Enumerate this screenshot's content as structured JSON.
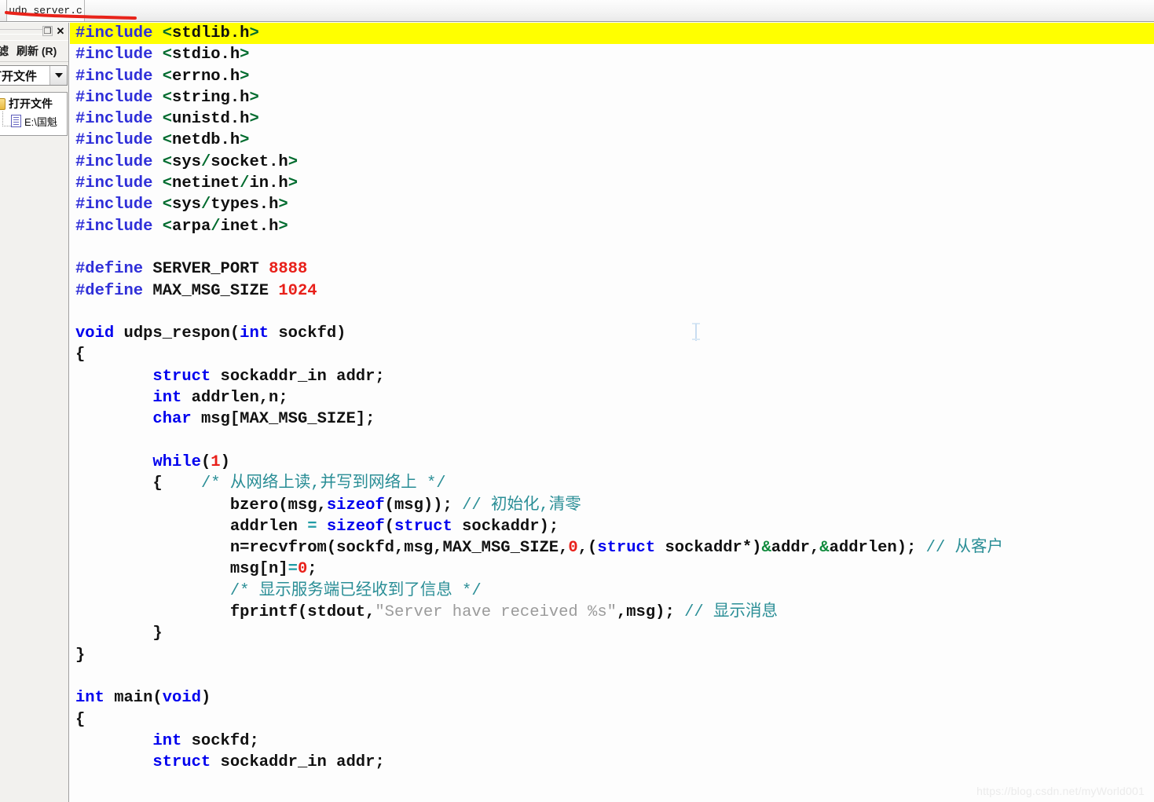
{
  "window": {
    "tab_label": "udp_server.c",
    "annotation": "red-underline-stroke"
  },
  "sidebar": {
    "minimize_label": "❐",
    "close_label": "✕",
    "toolbar": [
      {
        "label": "过滤",
        "name": "filter-button"
      },
      {
        "label": "刷新 (R)",
        "name": "refresh-button"
      }
    ],
    "combo": {
      "value": "打开文件",
      "arrow": "chevron-down-icon"
    },
    "tree": [
      {
        "label": "打开文件",
        "icon": "folder-icon",
        "level": 0
      },
      {
        "label": "E:\\国魁",
        "icon": "document-icon",
        "level": 1
      }
    ]
  },
  "editor": {
    "highlight_line": 1,
    "lines": [
      [
        {
          "t": "#include",
          "c": "pp"
        },
        {
          "t": " ",
          "c": "pl"
        },
        {
          "t": "<",
          "c": "ang"
        },
        {
          "t": "stdlib",
          "c": "hdr"
        },
        {
          "t": ".",
          "c": "hdr"
        },
        {
          "t": "h",
          "c": "hdr"
        },
        {
          "t": ">",
          "c": "ang"
        }
      ],
      [
        {
          "t": "#include",
          "c": "pp"
        },
        {
          "t": " ",
          "c": "pl"
        },
        {
          "t": "<",
          "c": "ang"
        },
        {
          "t": "stdio.h",
          "c": "hdr"
        },
        {
          "t": ">",
          "c": "ang"
        }
      ],
      [
        {
          "t": "#include",
          "c": "pp"
        },
        {
          "t": " ",
          "c": "pl"
        },
        {
          "t": "<",
          "c": "ang"
        },
        {
          "t": "errno.h",
          "c": "hdr"
        },
        {
          "t": ">",
          "c": "ang"
        }
      ],
      [
        {
          "t": "#include",
          "c": "pp"
        },
        {
          "t": " ",
          "c": "pl"
        },
        {
          "t": "<",
          "c": "ang"
        },
        {
          "t": "string.h",
          "c": "hdr"
        },
        {
          "t": ">",
          "c": "ang"
        }
      ],
      [
        {
          "t": "#include",
          "c": "pp"
        },
        {
          "t": " ",
          "c": "pl"
        },
        {
          "t": "<",
          "c": "ang"
        },
        {
          "t": "unistd.h",
          "c": "hdr"
        },
        {
          "t": ">",
          "c": "ang"
        }
      ],
      [
        {
          "t": "#include",
          "c": "pp"
        },
        {
          "t": " ",
          "c": "pl"
        },
        {
          "t": "<",
          "c": "ang"
        },
        {
          "t": "netdb.h",
          "c": "hdr"
        },
        {
          "t": ">",
          "c": "ang"
        }
      ],
      [
        {
          "t": "#include",
          "c": "pp"
        },
        {
          "t": " ",
          "c": "pl"
        },
        {
          "t": "<",
          "c": "ang"
        },
        {
          "t": "sys",
          "c": "hdr"
        },
        {
          "t": "/",
          "c": "ang"
        },
        {
          "t": "socket.h",
          "c": "hdr"
        },
        {
          "t": ">",
          "c": "ang"
        }
      ],
      [
        {
          "t": "#include",
          "c": "pp"
        },
        {
          "t": " ",
          "c": "pl"
        },
        {
          "t": "<",
          "c": "ang"
        },
        {
          "t": "netinet",
          "c": "hdr"
        },
        {
          "t": "/",
          "c": "ang"
        },
        {
          "t": "in.h",
          "c": "hdr"
        },
        {
          "t": ">",
          "c": "ang"
        }
      ],
      [
        {
          "t": "#include",
          "c": "pp"
        },
        {
          "t": " ",
          "c": "pl"
        },
        {
          "t": "<",
          "c": "ang"
        },
        {
          "t": "sys",
          "c": "hdr"
        },
        {
          "t": "/",
          "c": "ang"
        },
        {
          "t": "types.h",
          "c": "hdr"
        },
        {
          "t": ">",
          "c": "ang"
        }
      ],
      [
        {
          "t": "#include",
          "c": "pp"
        },
        {
          "t": " ",
          "c": "pl"
        },
        {
          "t": "<",
          "c": "ang"
        },
        {
          "t": "arpa",
          "c": "hdr"
        },
        {
          "t": "/",
          "c": "ang"
        },
        {
          "t": "inet.h",
          "c": "hdr"
        },
        {
          "t": ">",
          "c": "ang"
        }
      ],
      [],
      [
        {
          "t": "#define",
          "c": "pp"
        },
        {
          "t": " SERVER_PORT ",
          "c": "id"
        },
        {
          "t": "8888",
          "c": "num"
        }
      ],
      [
        {
          "t": "#define",
          "c": "pp"
        },
        {
          "t": " MAX_MSG_SIZE ",
          "c": "id"
        },
        {
          "t": "1024",
          "c": "num"
        }
      ],
      [],
      [
        {
          "t": "void",
          "c": "kw"
        },
        {
          "t": " udps_respon(",
          "c": "pl"
        },
        {
          "t": "int",
          "c": "kw"
        },
        {
          "t": " sockfd)",
          "c": "pl"
        }
      ],
      [
        {
          "t": "{",
          "c": "pl"
        }
      ],
      [
        {
          "t": "        ",
          "c": "pl"
        },
        {
          "t": "struct",
          "c": "kw"
        },
        {
          "t": " sockaddr_in addr;",
          "c": "pl"
        }
      ],
      [
        {
          "t": "        ",
          "c": "pl"
        },
        {
          "t": "int",
          "c": "kw"
        },
        {
          "t": " addrlen,n;",
          "c": "pl"
        }
      ],
      [
        {
          "t": "        ",
          "c": "pl"
        },
        {
          "t": "char",
          "c": "kw"
        },
        {
          "t": " msg[MAX_MSG_SIZE];",
          "c": "pl"
        }
      ],
      [],
      [
        {
          "t": "        ",
          "c": "pl"
        },
        {
          "t": "while",
          "c": "kw"
        },
        {
          "t": "(",
          "c": "pl"
        },
        {
          "t": "1",
          "c": "num"
        },
        {
          "t": ")",
          "c": "pl"
        }
      ],
      [
        {
          "t": "        {    ",
          "c": "pl"
        },
        {
          "t": "/* 从网络上读,并写到网络上 */",
          "c": "cmt"
        }
      ],
      [
        {
          "t": "                bzero(msg,",
          "c": "pl"
        },
        {
          "t": "sizeof",
          "c": "kw"
        },
        {
          "t": "(msg)); ",
          "c": "pl"
        },
        {
          "t": "// 初始化,清零",
          "c": "cmt"
        }
      ],
      [
        {
          "t": "                addrlen ",
          "c": "pl"
        },
        {
          "t": "=",
          "c": "op"
        },
        {
          "t": " ",
          "c": "pl"
        },
        {
          "t": "sizeof",
          "c": "kw"
        },
        {
          "t": "(",
          "c": "pl"
        },
        {
          "t": "struct",
          "c": "kw"
        },
        {
          "t": " sockaddr);",
          "c": "pl"
        }
      ],
      [
        {
          "t": "                n=recvfrom(sockfd,msg,MAX_MSG_SIZE,",
          "c": "pl"
        },
        {
          "t": "0",
          "c": "num"
        },
        {
          "t": ",(",
          "c": "pl"
        },
        {
          "t": "struct",
          "c": "kw"
        },
        {
          "t": " sockaddr*)",
          "c": "pl"
        },
        {
          "t": "&",
          "c": "amp"
        },
        {
          "t": "addr,",
          "c": "pl"
        },
        {
          "t": "&",
          "c": "amp"
        },
        {
          "t": "addrlen); ",
          "c": "pl"
        },
        {
          "t": "// 从客户",
          "c": "cmt"
        }
      ],
      [
        {
          "t": "                msg[n]",
          "c": "pl"
        },
        {
          "t": "=",
          "c": "op"
        },
        {
          "t": "0",
          "c": "num"
        },
        {
          "t": ";",
          "c": "pl"
        }
      ],
      [
        {
          "t": "                ",
          "c": "pl"
        },
        {
          "t": "/* 显示服务端已经收到了信息 */",
          "c": "cmt"
        }
      ],
      [
        {
          "t": "                fprintf(stdout,",
          "c": "pl"
        },
        {
          "t": "\"Server have received %s\"",
          "c": "str"
        },
        {
          "t": ",msg); ",
          "c": "pl"
        },
        {
          "t": "// 显示消息",
          "c": "cmt"
        }
      ],
      [
        {
          "t": "        }",
          "c": "pl"
        }
      ],
      [
        {
          "t": "}",
          "c": "pl"
        }
      ],
      [],
      [
        {
          "t": "int",
          "c": "kw"
        },
        {
          "t": " main(",
          "c": "pl"
        },
        {
          "t": "void",
          "c": "kw"
        },
        {
          "t": ")",
          "c": "pl"
        }
      ],
      [
        {
          "t": "{",
          "c": "pl"
        }
      ],
      [
        {
          "t": "        ",
          "c": "pl"
        },
        {
          "t": "int",
          "c": "kw"
        },
        {
          "t": " sockfd;",
          "c": "pl"
        }
      ],
      [
        {
          "t": "        ",
          "c": "pl"
        },
        {
          "t": "struct",
          "c": "kw"
        },
        {
          "t": " sockaddr_in addr;",
          "c": "pl"
        }
      ]
    ]
  },
  "watermark": {
    "text": "https://blog.csdn.net/myWorld001"
  },
  "colors": {
    "highlight": "#ffff00",
    "keyword": "#0000ee",
    "preproc": "#2f2fd8",
    "angle": "#006b2e",
    "number": "#e8201a",
    "comment": "#2a8e96",
    "string": "#9b9b9b",
    "operator": "#1f9ba5",
    "ampersand": "#0f8a3c",
    "annotation": "#e8231a"
  }
}
